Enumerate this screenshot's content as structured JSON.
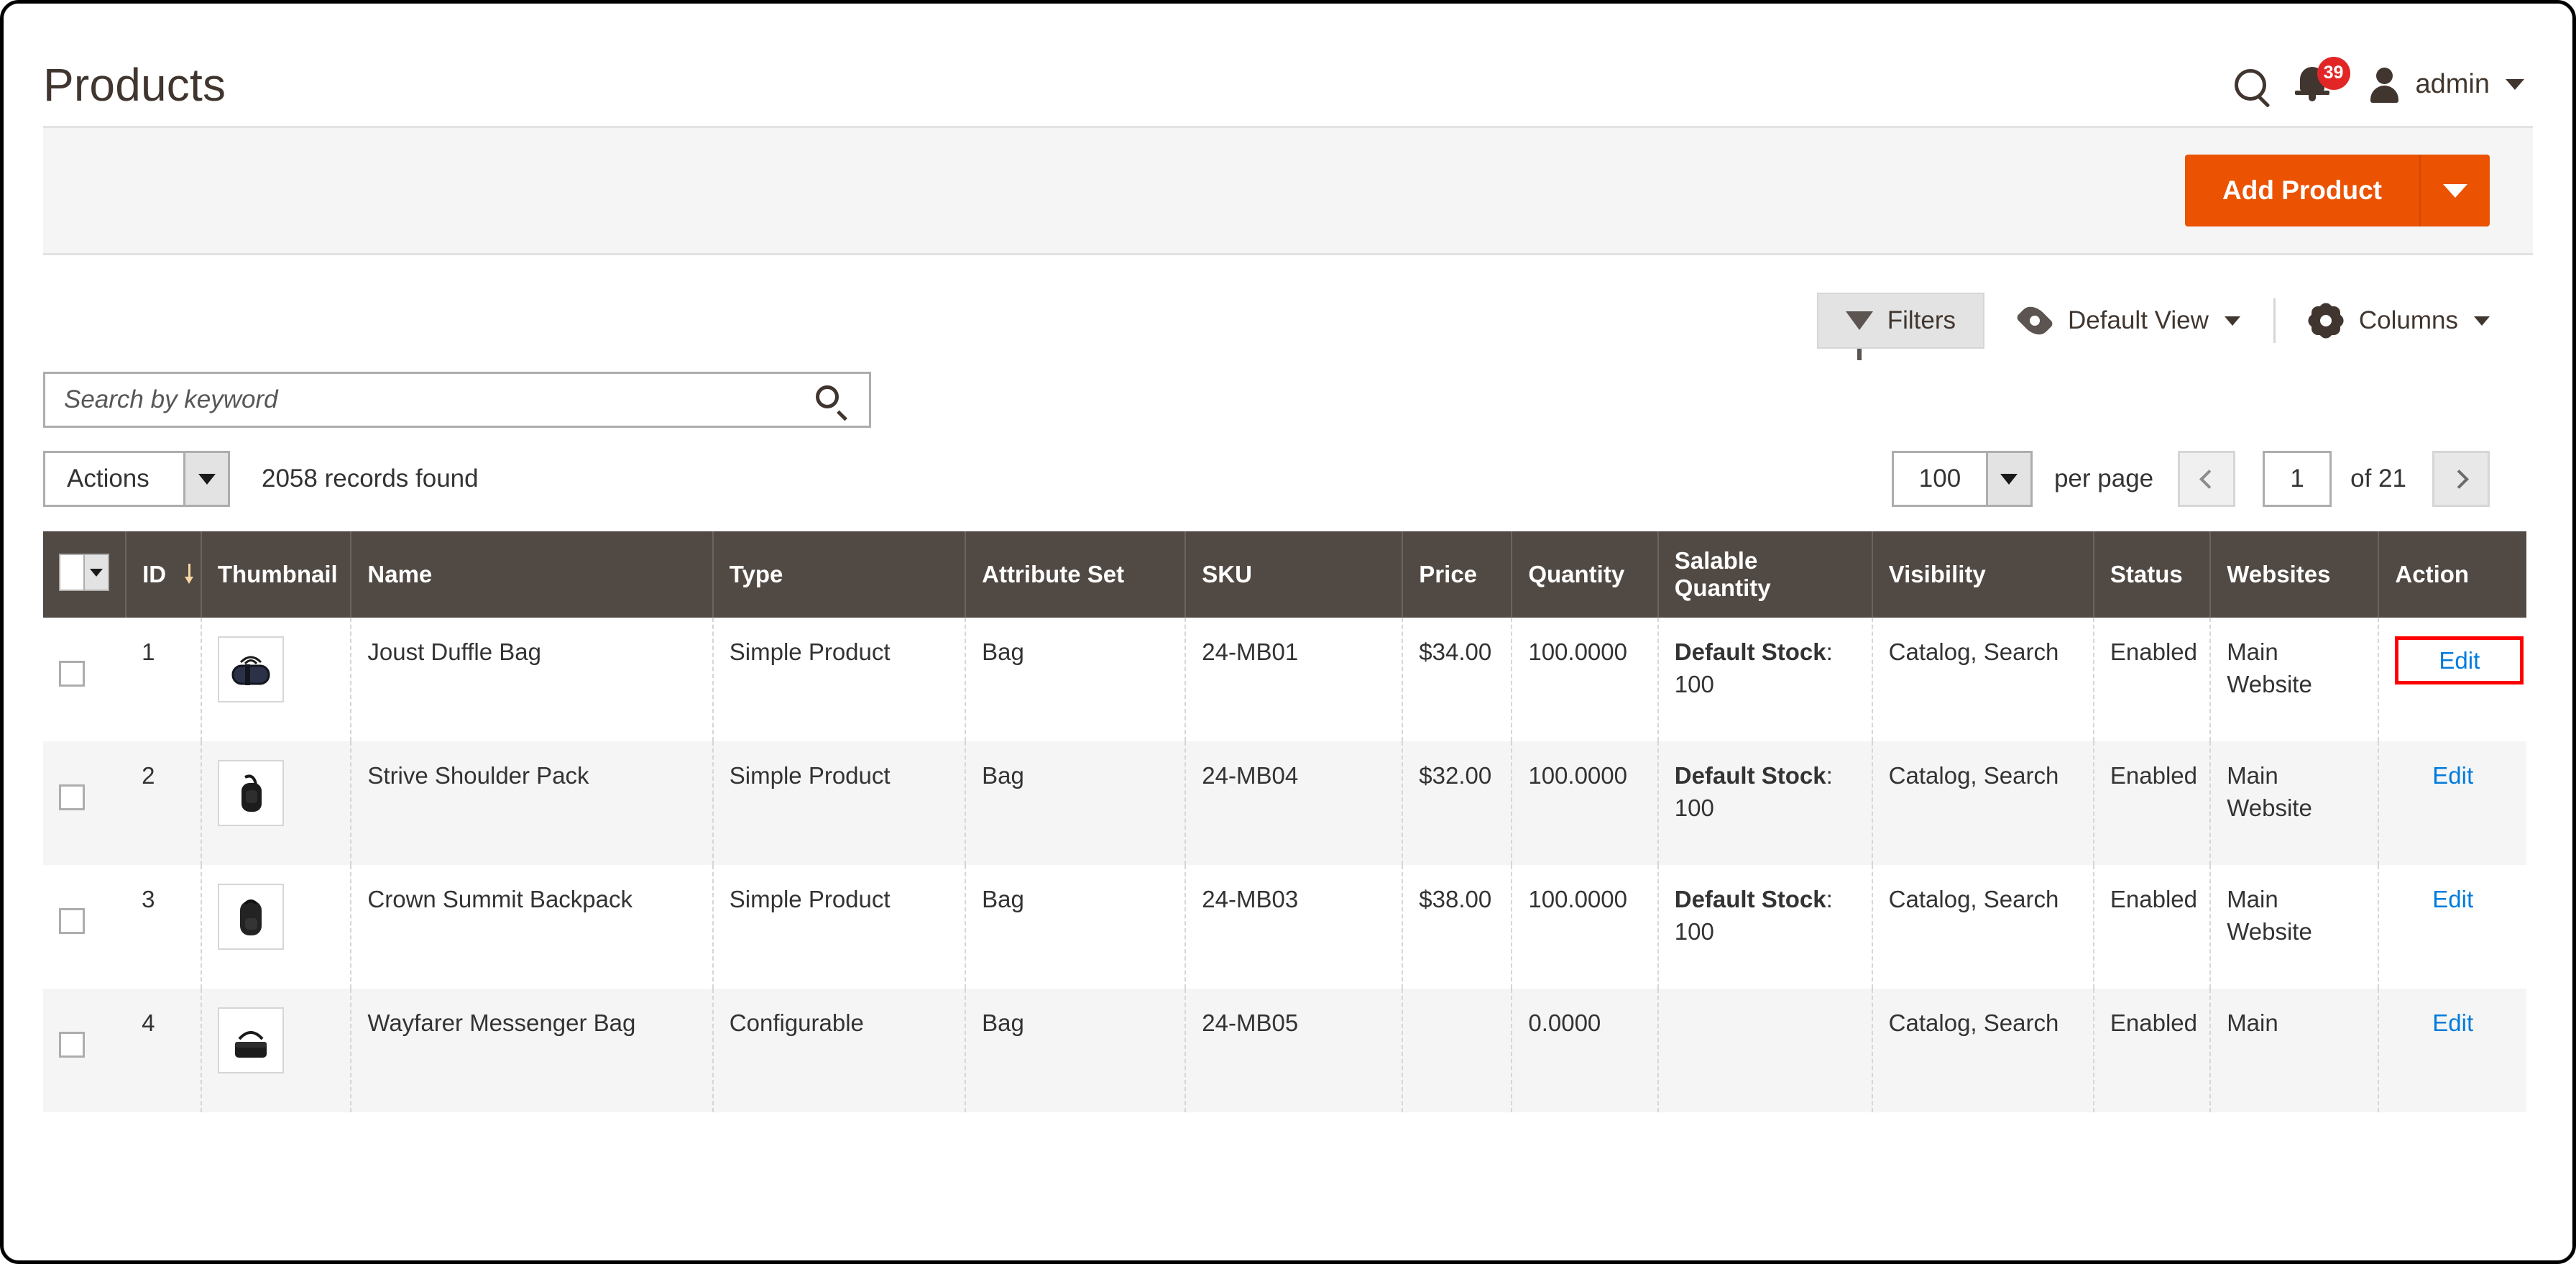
{
  "header": {
    "title": "Products",
    "search_icon": "search-icon",
    "notifications_icon": "bell-icon",
    "notifications_count": "39",
    "user_icon": "user-icon",
    "admin_label": "admin",
    "admin_caret": "chevron-down-icon"
  },
  "action_bar": {
    "add_product_label": "Add Product",
    "add_product_caret": "chevron-down-icon"
  },
  "grid_tools": {
    "filters_label": "Filters",
    "filters_icon": "funnel-icon",
    "view_label": "Default View",
    "view_icon": "eye-icon",
    "view_caret": "chevron-down-icon",
    "columns_label": "Columns",
    "columns_icon": "gear-icon",
    "columns_caret": "chevron-down-icon"
  },
  "search": {
    "placeholder": "Search by keyword",
    "value": "",
    "icon": "search-icon"
  },
  "toolbar": {
    "actions_label": "Actions",
    "actions_caret": "chevron-down-icon",
    "records_found": "2058 records found",
    "per_page_value": "100",
    "per_page_caret": "chevron-down-icon",
    "per_page_label": "per page",
    "prev_icon": "chevron-left-icon",
    "next_icon": "chevron-right-icon",
    "current_page": "1",
    "of_total": "of 21"
  },
  "grid": {
    "columns": [
      {
        "key": "select",
        "label": ""
      },
      {
        "key": "id",
        "label": "ID",
        "sorted": "desc",
        "sort_icon": "sort-arrow-down-icon"
      },
      {
        "key": "thumbnail",
        "label": "Thumbnail"
      },
      {
        "key": "name",
        "label": "Name"
      },
      {
        "key": "type",
        "label": "Type"
      },
      {
        "key": "attr_set",
        "label": "Attribute Set"
      },
      {
        "key": "sku",
        "label": "SKU"
      },
      {
        "key": "price",
        "label": "Price"
      },
      {
        "key": "quantity",
        "label": "Quantity"
      },
      {
        "key": "salable",
        "label": "Salable Quantity"
      },
      {
        "key": "visibility",
        "label": "Visibility"
      },
      {
        "key": "status",
        "label": "Status"
      },
      {
        "key": "websites",
        "label": "Websites"
      },
      {
        "key": "action",
        "label": "Action"
      }
    ],
    "rows": [
      {
        "id": "1",
        "thumbnail": "duffle-bag-thumbnail",
        "name": "Joust Duffle Bag",
        "type": "Simple Product",
        "attr_set": "Bag",
        "sku": "24-MB01",
        "price": "$34.00",
        "quantity": "100.0000",
        "salable_label": "Default Stock",
        "salable_value": "100",
        "visibility": "Catalog, Search",
        "status": "Enabled",
        "websites": "Main Website",
        "action": "Edit",
        "action_highlighted": true
      },
      {
        "id": "2",
        "thumbnail": "shoulder-pack-thumbnail",
        "name": "Strive Shoulder Pack",
        "type": "Simple Product",
        "attr_set": "Bag",
        "sku": "24-MB04",
        "price": "$32.00",
        "quantity": "100.0000",
        "salable_label": "Default Stock",
        "salable_value": "100",
        "visibility": "Catalog, Search",
        "status": "Enabled",
        "websites": "Main Website",
        "action": "Edit",
        "action_highlighted": false
      },
      {
        "id": "3",
        "thumbnail": "backpack-thumbnail",
        "name": "Crown Summit Backpack",
        "type": "Simple Product",
        "attr_set": "Bag",
        "sku": "24-MB03",
        "price": "$38.00",
        "quantity": "100.0000",
        "salable_label": "Default Stock",
        "salable_value": "100",
        "visibility": "Catalog, Search",
        "status": "Enabled",
        "websites": "Main Website",
        "action": "Edit",
        "action_highlighted": false
      },
      {
        "id": "4",
        "thumbnail": "messenger-bag-thumbnail",
        "name": "Wayfarer Messenger Bag",
        "type": "Configurable",
        "attr_set": "Bag",
        "sku": "24-MB05",
        "price": "",
        "quantity": "0.0000",
        "salable_label": "",
        "salable_value": "",
        "visibility": "Catalog, Search",
        "status": "Enabled",
        "websites": "Main",
        "action": "Edit",
        "action_highlighted": false
      }
    ]
  },
  "colors": {
    "accent_orange": "#eb5202",
    "header_dark": "#514943",
    "link_blue": "#007bdb",
    "badge_red": "#e22626",
    "highlight_red": "#ff0000"
  }
}
